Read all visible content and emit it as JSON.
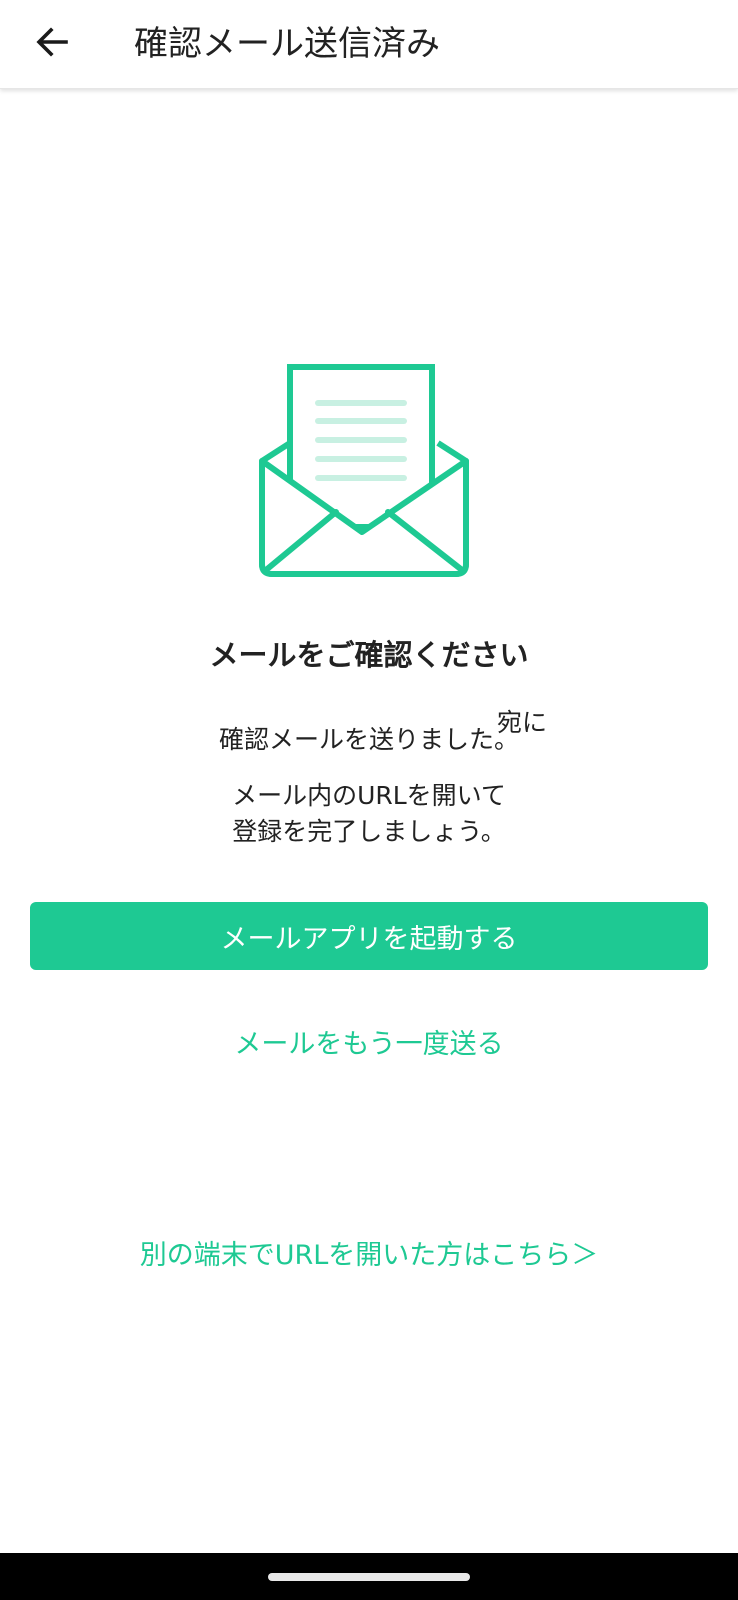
{
  "header": {
    "title": "確認メール送信済み",
    "back_icon": "arrow-left-icon"
  },
  "illustration": {
    "icon": "open-envelope-letter-icon",
    "accent_color": "#1ec993",
    "lines_color": "#c8f0e2"
  },
  "main": {
    "headline": "メールをご確認ください",
    "sent_to_suffix": "宛に",
    "sent_line": "確認メールを送りました。",
    "instruction_line1": "メール内のURLを開いて",
    "instruction_line2": "登録を完了しましょう。"
  },
  "actions": {
    "open_mail_app": "メールアプリを起動する",
    "resend_mail": "メールをもう一度送る",
    "other_device": "別の端末でURLを開いた方はこちら＞"
  },
  "colors": {
    "primary": "#1ec993",
    "text": "#222222",
    "background": "#ffffff"
  }
}
